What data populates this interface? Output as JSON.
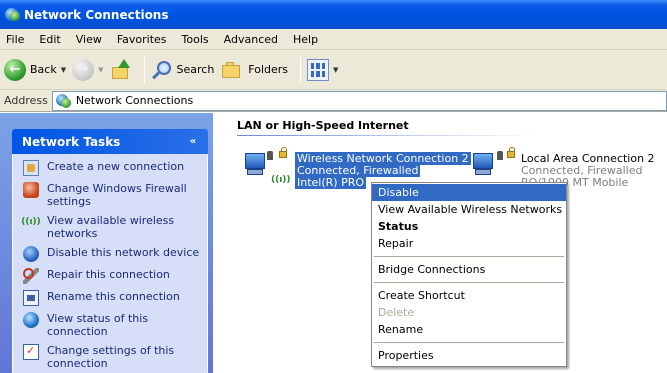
{
  "window": {
    "title": "Network Connections",
    "title_icon": "network-connections-icon"
  },
  "menubar": {
    "items": [
      "File",
      "Edit",
      "View",
      "Favorites",
      "Tools",
      "Advanced",
      "Help"
    ]
  },
  "toolbar": {
    "back_label": "Back",
    "search_label": "Search",
    "folders_label": "Folders"
  },
  "address": {
    "label": "Address",
    "value": "Network Connections"
  },
  "tasks": {
    "title": "Network Tasks",
    "collapse_glyph": "«",
    "items": [
      {
        "label": "Create a new connection",
        "icon": "new-connection-icon"
      },
      {
        "label": "Change Windows Firewall settings",
        "icon": "firewall-icon"
      },
      {
        "label": "View available wireless networks",
        "icon": "wireless-icon"
      },
      {
        "label": "Disable this network device",
        "icon": "disable-device-icon"
      },
      {
        "label": "Repair this connection",
        "icon": "repair-icon"
      },
      {
        "label": "Rename this connection",
        "icon": "rename-icon"
      },
      {
        "label": "View status of this connection",
        "icon": "status-icon"
      },
      {
        "label": "Change settings of this connection",
        "icon": "settings-icon"
      }
    ]
  },
  "main": {
    "group_title": "LAN or High-Speed Internet",
    "connections": [
      {
        "name": "Wireless Network Connection 2",
        "status": "Connected, Firewalled",
        "device": "Intel(R) PRO",
        "selected": true,
        "wireless_glyph": "((ı))"
      },
      {
        "name": "Local Area Connection 2",
        "status": "Connected, Firewalled",
        "device": "RO/1000 MT Mobile",
        "selected": false
      }
    ]
  },
  "context_menu": {
    "items": [
      {
        "label": "Disable",
        "state": "highlighted"
      },
      {
        "label": "View Available Wireless Networks",
        "state": "normal"
      },
      {
        "label": "Status",
        "state": "default"
      },
      {
        "label": "Repair",
        "state": "normal"
      },
      {
        "separator": true
      },
      {
        "label": "Bridge Connections",
        "state": "normal"
      },
      {
        "separator": true
      },
      {
        "label": "Create Shortcut",
        "state": "normal"
      },
      {
        "label": "Delete",
        "state": "disabled"
      },
      {
        "label": "Rename",
        "state": "normal"
      },
      {
        "separator": true
      },
      {
        "label": "Properties",
        "state": "normal"
      }
    ]
  },
  "colors": {
    "titlebar": "#0054e3",
    "selection": "#316ac5",
    "task_pane": "#7ba2e7",
    "task_text": "#1a2a7a"
  }
}
